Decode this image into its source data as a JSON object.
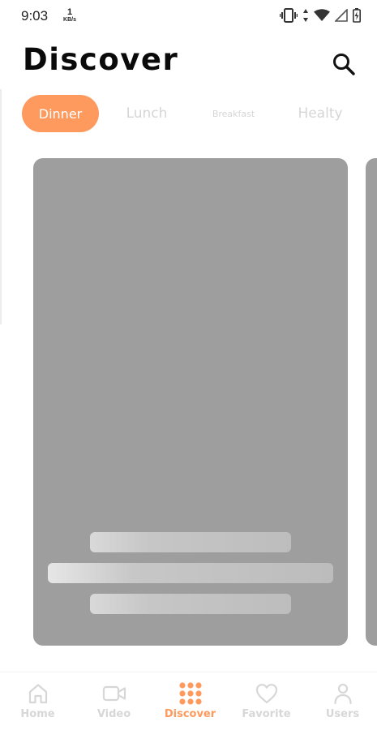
{
  "status_bar": {
    "time": "9:03",
    "net_speed_value": "1",
    "net_speed_unit": "KB/s",
    "icons": [
      "vibrate-icon",
      "data-arrows-icon",
      "wifi-icon",
      "signal-icon",
      "battery-icon"
    ]
  },
  "header": {
    "title": "Discover",
    "search_icon": "search-icon"
  },
  "tabs": [
    {
      "label": "Dinner",
      "active": true
    },
    {
      "label": "Lunch",
      "active": false
    },
    {
      "label": "Breakfast",
      "active": false
    },
    {
      "label": "Healty",
      "active": false
    }
  ],
  "bottom_nav": {
    "items": [
      {
        "label": "Home",
        "icon": "home-icon",
        "active": false
      },
      {
        "label": "Video",
        "icon": "video-icon",
        "active": false
      },
      {
        "label": "Discover",
        "icon": "grid-dots-icon",
        "active": true
      },
      {
        "label": "Favorite",
        "icon": "heart-icon",
        "active": false
      },
      {
        "label": "Users",
        "icon": "user-icon",
        "active": false
      }
    ]
  },
  "colors": {
    "accent": "#fe9a5e",
    "inactive": "#d7d7d7",
    "card_placeholder": "#9e9e9e"
  }
}
